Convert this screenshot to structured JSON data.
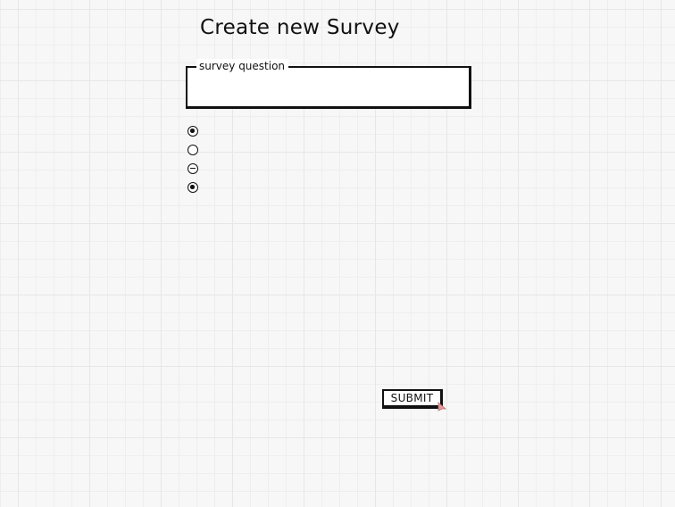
{
  "page": {
    "title": "Create new Survey"
  },
  "question_field": {
    "legend": "survey question",
    "value": ""
  },
  "radio_options": [
    {
      "state": "checked"
    },
    {
      "state": "unchecked"
    },
    {
      "state": "mixed"
    },
    {
      "state": "checked"
    }
  ],
  "submit": {
    "label": "SUBMIT"
  },
  "colors": {
    "ink": "#111111",
    "grid": "#e7e7e7",
    "background": "#f7f7f7",
    "cursor_accent": "#e79a9a"
  }
}
